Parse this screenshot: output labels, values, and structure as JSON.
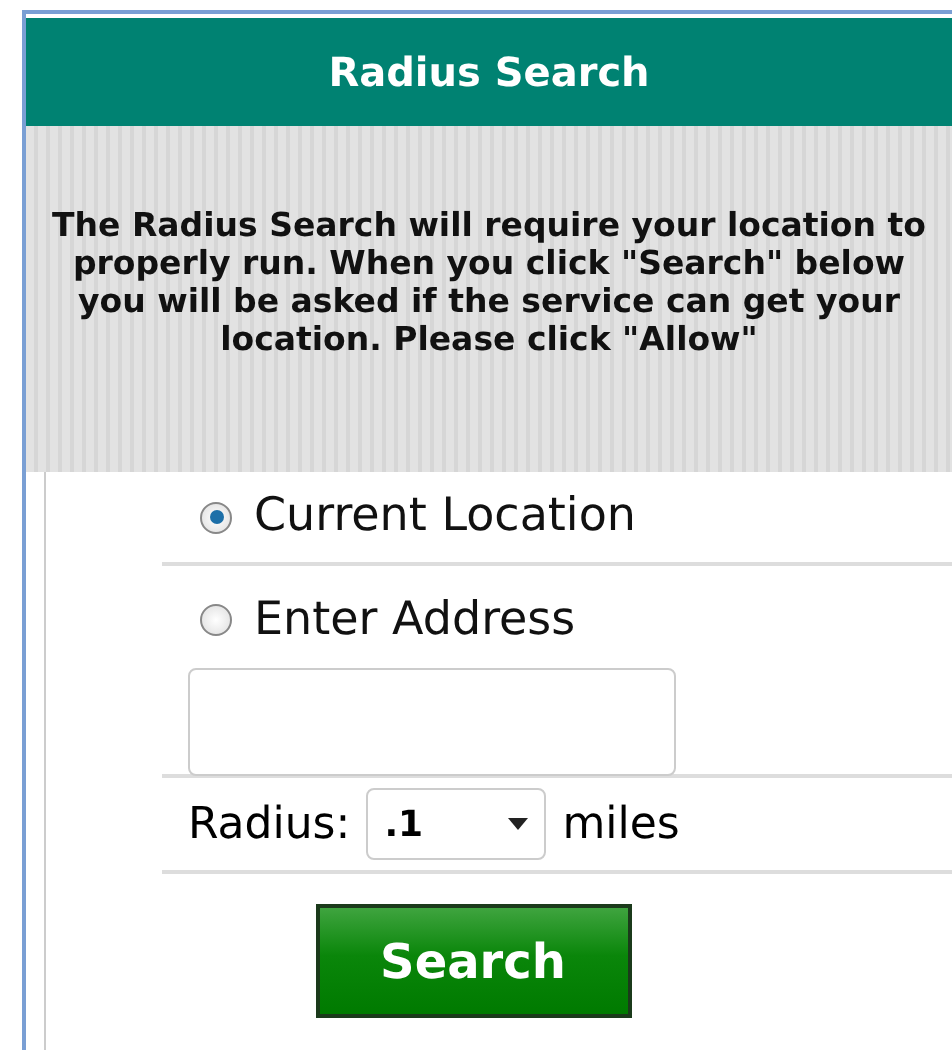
{
  "header": {
    "title": "Radius Search"
  },
  "notice": "The Radius Search will require your location to properly run. When you click \"Search\" below you will be asked if the service can get your location. Please click \"Allow\"",
  "options": [
    {
      "label": "Current Location",
      "selected": true
    },
    {
      "label": "Enter Address",
      "selected": false
    }
  ],
  "radius": {
    "label": "Radius:",
    "value": ".1",
    "unit": "miles"
  },
  "search_button": "Search"
}
